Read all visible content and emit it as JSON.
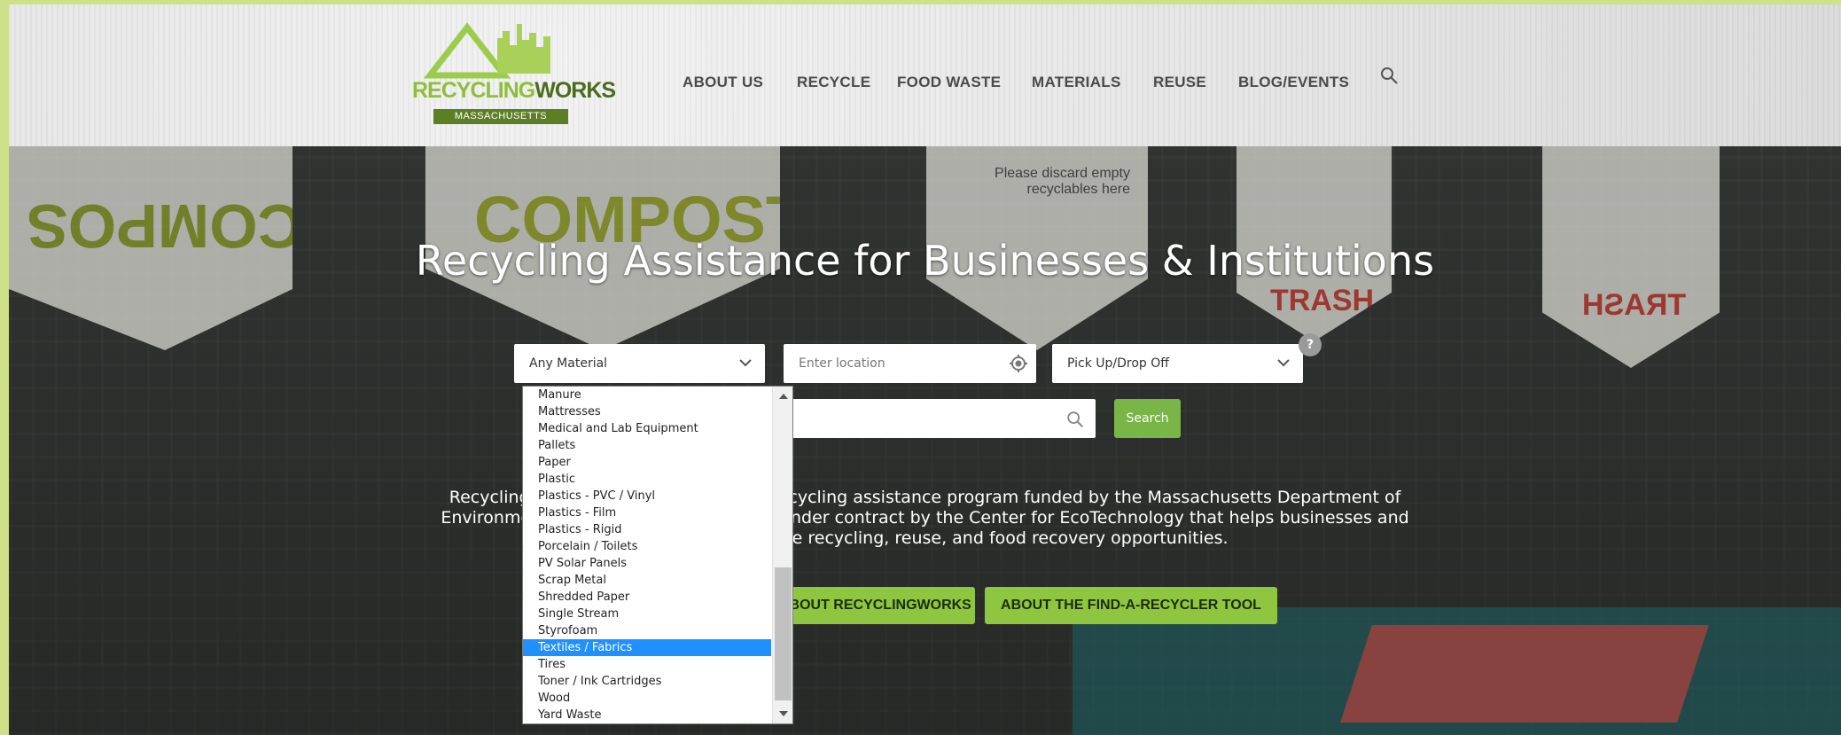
{
  "brand": {
    "logo_word_1": "RECYCLING",
    "logo_word_2": "WORKS",
    "logo_sub": "MASSACHUSETTS",
    "accent": "#8ec63f",
    "dark_green": "#5c7f25"
  },
  "nav": {
    "items": [
      {
        "label": "ABOUT US"
      },
      {
        "label": "RECYCLE"
      },
      {
        "label": "FOOD WASTE"
      },
      {
        "label": "MATERIALS"
      },
      {
        "label": "REUSE"
      },
      {
        "label": "BLOG/EVENTS"
      }
    ],
    "search_icon": "search-icon"
  },
  "hero": {
    "title": "Recycling Assistance for Businesses & Institutions",
    "background_banners": {
      "compost_left": "COMPOS",
      "compost_center": "COMPOST",
      "please_discard": "Please discard empty recyclables here",
      "trash": "TRASH",
      "trash_mirrored": "TRASH"
    },
    "material_select": {
      "value": "Any Material"
    },
    "location_input": {
      "placeholder": "Enter location"
    },
    "service_select": {
      "value": "Pick Up/Drop Off"
    },
    "help_badge": "?",
    "search_button": "Search",
    "description_lines": [
      "RecyclingWorks in Massachusetts is a recycling assistance program funded by the Massachusetts Department of",
      "Environmental Protection and delivered under contract by the Center for EcoTechnology that helps businesses and",
      "institutions maximize recycling, reuse, and food recovery opportunities."
    ],
    "cta_left": "LEARN ABOUT RECYCLINGWORKS",
    "cta_right": "ABOUT THE FIND-A-RECYCLER TOOL"
  },
  "material_dropdown": {
    "selected": "Textiles / Fabrics",
    "options": [
      "Manure",
      "Mattresses",
      "Medical and Lab Equipment",
      "Pallets",
      "Paper",
      "Plastic",
      "Plastics - PVC / Vinyl",
      "Plastics - Film",
      "Plastics - Rigid",
      "Porcelain / Toilets",
      "PV Solar Panels",
      "Scrap Metal",
      "Shredded Paper",
      "Single Stream",
      "Styrofoam",
      "Textiles / Fabrics",
      "Tires",
      "Toner / Ink Cartridges",
      "Wood",
      "Yard Waste"
    ],
    "selection_color": "#1e90ff"
  }
}
